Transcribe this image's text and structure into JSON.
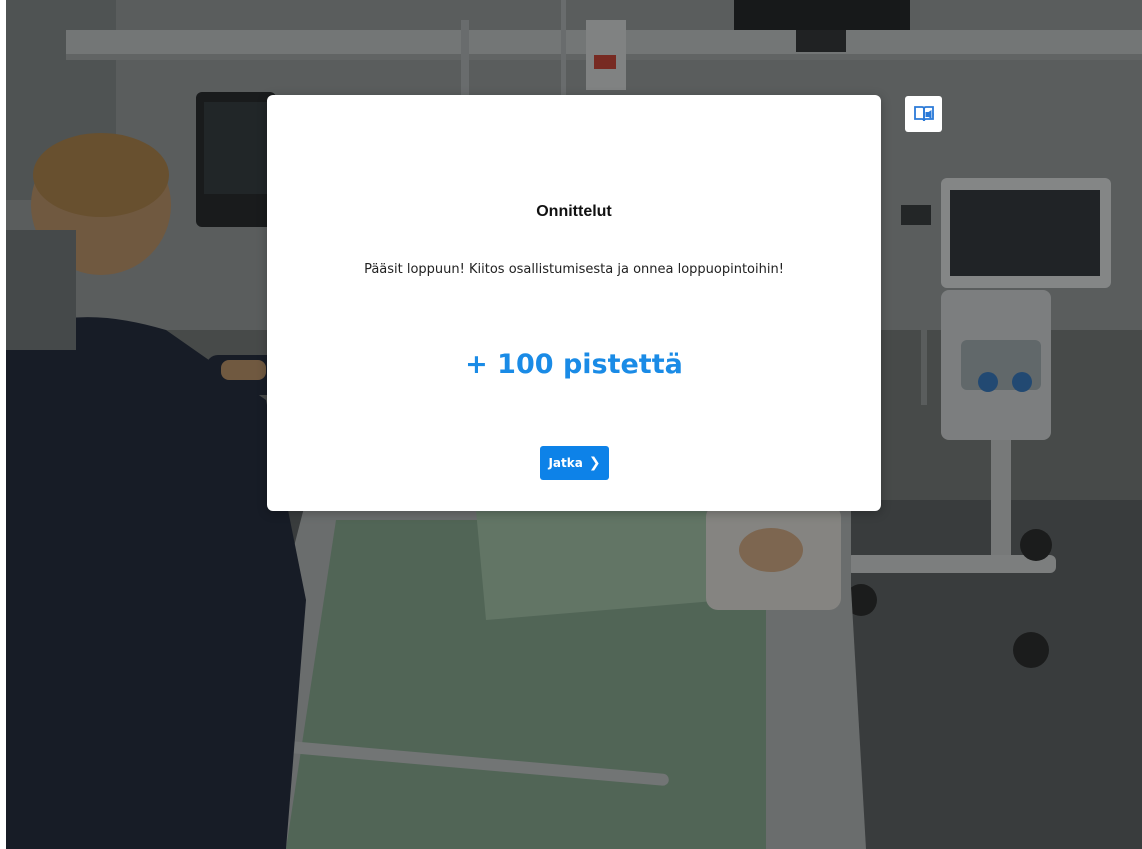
{
  "dialog": {
    "title": "Onnittelut",
    "message": "Pääsit loppuun! Kiitos osallistumisesta ja onnea loppuopintoihin!",
    "points": "+ 100 pistettä",
    "continue_label": "Jatka",
    "continue_icon": "chevron-right-icon"
  },
  "toolbar": {
    "reader_icon": "immersive-reader-icon"
  },
  "colors": {
    "accent": "#0d82e8",
    "points_text": "#1a8be6",
    "overlay": "#000000",
    "reader_icon": "#2b7ad8"
  }
}
